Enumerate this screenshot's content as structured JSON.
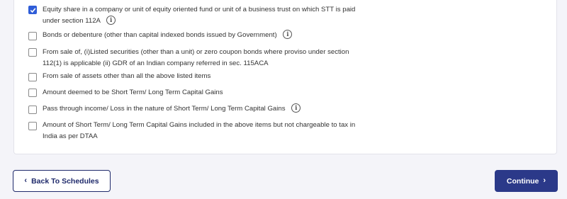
{
  "options": [
    {
      "checked": true,
      "line1": "Equity share in a company or unit of equity oriented fund or unit of a business trust on which STT is paid",
      "line2": "under section 112A",
      "info": true
    },
    {
      "checked": false,
      "line1": "Bonds or debenture (other than capital indexed bonds issued by Government)",
      "line2": "",
      "info": true
    },
    {
      "checked": false,
      "line1": "From sale of, (i)Listed securities (other than a unit) or zero coupon bonds where proviso under section",
      "line2": "112(1) is applicable (ii) GDR of an Indian company referred in sec. 115ACA",
      "info": false
    },
    {
      "checked": false,
      "line1": "From sale of assets other than all the above listed items",
      "line2": "",
      "info": false
    },
    {
      "checked": false,
      "line1": "Amount deemed to be Short Term/ Long Term Capital Gains",
      "line2": "",
      "info": false
    },
    {
      "checked": false,
      "line1": "Pass through income/ Loss in the nature of Short Term/ Long Term Capital Gains",
      "line2": "",
      "info": true
    },
    {
      "checked": false,
      "line1": "Amount of Short Term/ Long Term Capital Gains included in the above items but not chargeable to tax in",
      "line2": "India as per DTAA",
      "info": false
    }
  ],
  "info_glyph": "i",
  "footer": {
    "back_label": "Back To Schedules",
    "continue_label": "Continue",
    "back_chevron": "‹",
    "continue_chevron": "›"
  },
  "colors": {
    "accent": "#2f5dd8",
    "primary_button": "#2b3989",
    "back_button_text": "#1f2a6b"
  }
}
